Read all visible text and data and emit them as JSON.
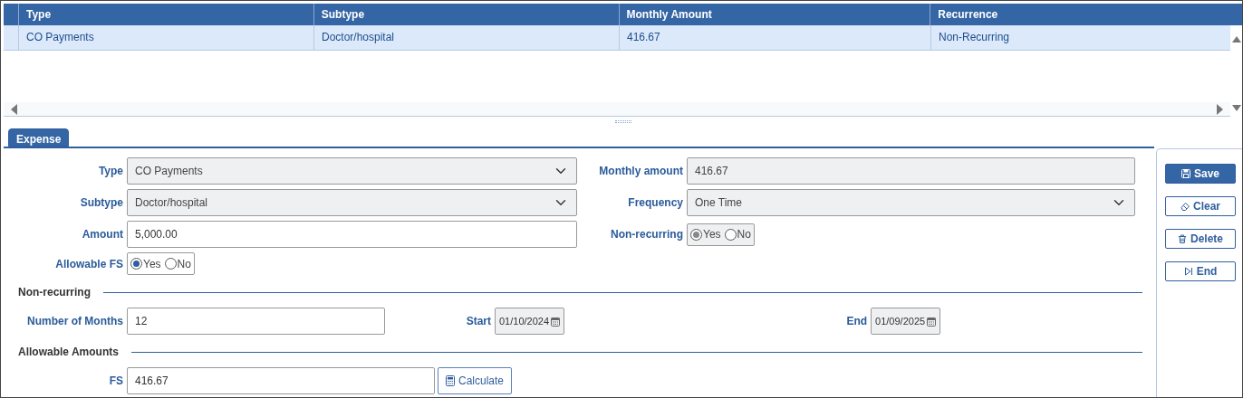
{
  "grid": {
    "columns": [
      "Type",
      "Subtype",
      "Monthly Amount",
      "Recurrence"
    ],
    "rows": [
      {
        "cells": [
          "CO Payments",
          "Doctor/hospital",
          "416.67",
          "Non-Recurring"
        ],
        "selected": true
      }
    ]
  },
  "tabs": [
    {
      "label": "Expense",
      "selected": true
    }
  ],
  "form": {
    "rows": [
      [
        {
          "label": "Type",
          "kind": "select",
          "value": "CO Payments",
          "disabled": true
        },
        {
          "label": "Monthly amount",
          "kind": "text",
          "value": "416.67",
          "disabled": true
        }
      ],
      [
        {
          "label": "Subtype",
          "kind": "select",
          "value": "Doctor/hospital",
          "disabled": true
        },
        {
          "label": "Frequency",
          "kind": "select",
          "value": "One Time",
          "disabled": true
        }
      ],
      [
        {
          "label": "Amount",
          "kind": "text",
          "value": "5,000.00",
          "disabled": false
        },
        {
          "label": "Non-recurring",
          "kind": "radio",
          "disabled": true,
          "options": [
            {
              "label": "Yes",
              "selected": true
            },
            {
              "label": "No",
              "selected": false
            }
          ]
        }
      ],
      [
        {
          "label": "Allowable FS",
          "kind": "radio",
          "disabled": false,
          "options": [
            {
              "label": "Yes",
              "selected": true
            },
            {
              "label": "No",
              "selected": false
            }
          ]
        }
      ]
    ]
  },
  "non_recurring": {
    "title": "Non-recurring",
    "fields": [
      {
        "label": "Number of Months",
        "kind": "text",
        "value": "12",
        "disabled": false
      },
      {
        "label": "Start",
        "kind": "date",
        "value": "01/10/2024",
        "disabled": true
      },
      {
        "label": "End",
        "kind": "date",
        "value": "01/09/2025",
        "disabled": true
      }
    ]
  },
  "allowable_amounts": {
    "title": "Allowable Amounts",
    "fs": {
      "label": "FS",
      "value": "416.67"
    },
    "calculate": {
      "label": "Calculate"
    }
  },
  "actions": [
    {
      "label": "Save",
      "kind": "save",
      "primary": true
    },
    {
      "label": "Clear",
      "kind": "clear",
      "primary": false
    },
    {
      "label": "Delete",
      "kind": "delete",
      "primary": false
    },
    {
      "label": "End",
      "kind": "end",
      "primary": false
    }
  ]
}
